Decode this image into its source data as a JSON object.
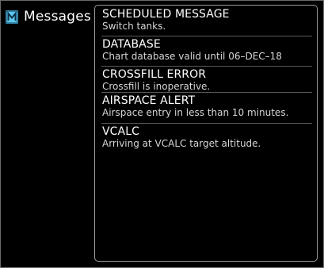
{
  "sidebar": {
    "icon": "messages-icon",
    "icon_color": "#5ec8f0",
    "title": "Messages"
  },
  "messages": [
    {
      "title": "SCHEDULED MESSAGE",
      "body": "Switch tanks."
    },
    {
      "title": "DATABASE",
      "body": "Chart database valid until 06–DEC–18"
    },
    {
      "title": "CROSSFILL ERROR",
      "body": "Crossfill is inoperative."
    },
    {
      "title": "AIRSPACE ALERT",
      "body": "Airspace entry in less than 10 minutes."
    },
    {
      "title": "VCALC",
      "body": "Arriving at VCALC target altitude."
    }
  ]
}
